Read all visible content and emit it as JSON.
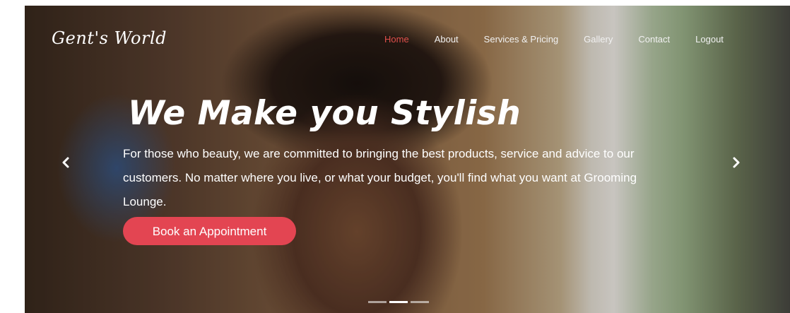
{
  "brand": {
    "name": "Gent's World"
  },
  "nav": {
    "items": [
      {
        "label": "Home",
        "active": true
      },
      {
        "label": "About"
      },
      {
        "label": "Services & Pricing"
      },
      {
        "label": "Gallery"
      },
      {
        "label": "Contact"
      },
      {
        "label": "Logout"
      }
    ]
  },
  "hero": {
    "title": "We Make you Stylish",
    "lead": "For those who beauty, we are committed to bringing the best products, service and advice to our customers. No matter where you live, or what your budget, you'll find what you want at Grooming Lounge.",
    "cta": "Book an Appointment",
    "carousel": {
      "slides": 3,
      "active_index": 1,
      "prev_icon": "chevron-left-icon",
      "next_icon": "chevron-right-icon"
    }
  },
  "colors": {
    "accent": "#e34552",
    "nav_active": "#e0504b",
    "text": "#ffffff"
  }
}
